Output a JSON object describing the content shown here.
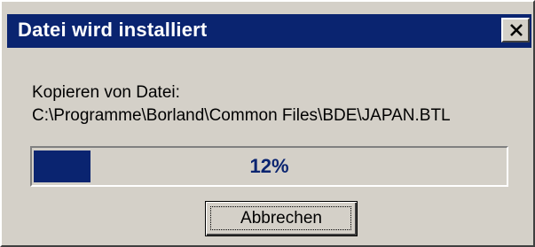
{
  "dialog": {
    "title": "Datei wird installiert",
    "close_icon": "close-x-icon",
    "message_label": "Kopieren von Datei:",
    "file_path": "C:\\Programme\\Borland\\Common Files\\BDE\\JAPAN.BTL",
    "progress": {
      "percent": 12,
      "text": "12%",
      "fill_color": "#0a2470"
    },
    "cancel_label": "Abbrechen"
  },
  "colors": {
    "titlebar": "#0a2470",
    "face": "#d4d0c8",
    "progress_text": "#0a2470"
  }
}
